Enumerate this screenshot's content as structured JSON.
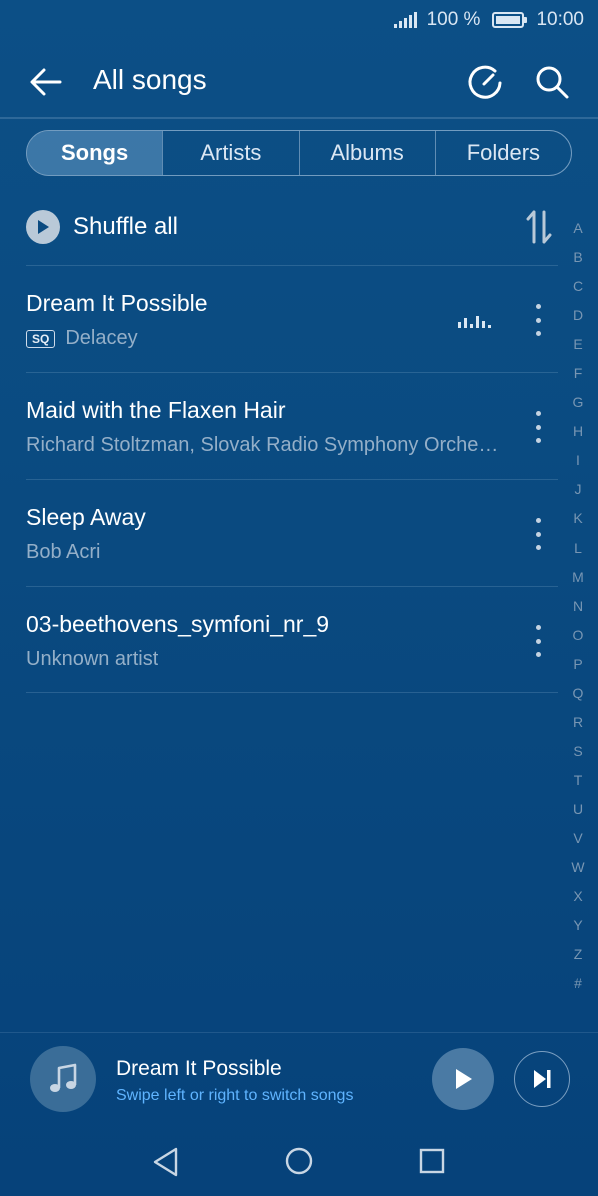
{
  "status_bar": {
    "battery_percent": "100 %",
    "time": "10:00",
    "icons": [
      "signal-icon",
      "battery-icon"
    ]
  },
  "header": {
    "title": "All songs",
    "icons": [
      "back-arrow-icon",
      "refresh-icon",
      "search-icon"
    ]
  },
  "tabs": [
    {
      "label": "Songs",
      "active": true
    },
    {
      "label": "Artists",
      "active": false
    },
    {
      "label": "Albums",
      "active": false
    },
    {
      "label": "Folders",
      "active": false
    }
  ],
  "shuffle": {
    "label": "Shuffle all",
    "icons": [
      "play-icon",
      "sort-icon"
    ]
  },
  "songs": [
    {
      "title": "Dream It Possible",
      "artist": "Delacey",
      "badge": "SQ",
      "playing": true
    },
    {
      "title": "Maid with the Flaxen Hair",
      "artist": "Richard Stoltzman, Slovak Radio Symphony Orche…"
    },
    {
      "title": "Sleep Away",
      "artist": "Bob Acri"
    },
    {
      "title": "03-beethovens_symfoni_nr_9",
      "artist": "Unknown artist"
    }
  ],
  "alpha_index": [
    "A",
    "B",
    "C",
    "D",
    "E",
    "F",
    "G",
    "H",
    "I",
    "J",
    "K",
    "L",
    "M",
    "N",
    "O",
    "P",
    "Q",
    "R",
    "S",
    "T",
    "U",
    "V",
    "W",
    "X",
    "Y",
    "Z",
    "#"
  ],
  "now_playing": {
    "title": "Dream It Possible",
    "hint": "Swipe left or right to switch songs",
    "icons": [
      "music-note-icon",
      "play-icon",
      "next-track-icon"
    ]
  },
  "nav_bar": {
    "icons": [
      "nav-back-icon",
      "nav-home-icon",
      "nav-recents-icon"
    ]
  },
  "colors": {
    "background": "#0a4a80",
    "accent_hint": "#5fb4ff",
    "secondary_text": "#94afc8"
  }
}
